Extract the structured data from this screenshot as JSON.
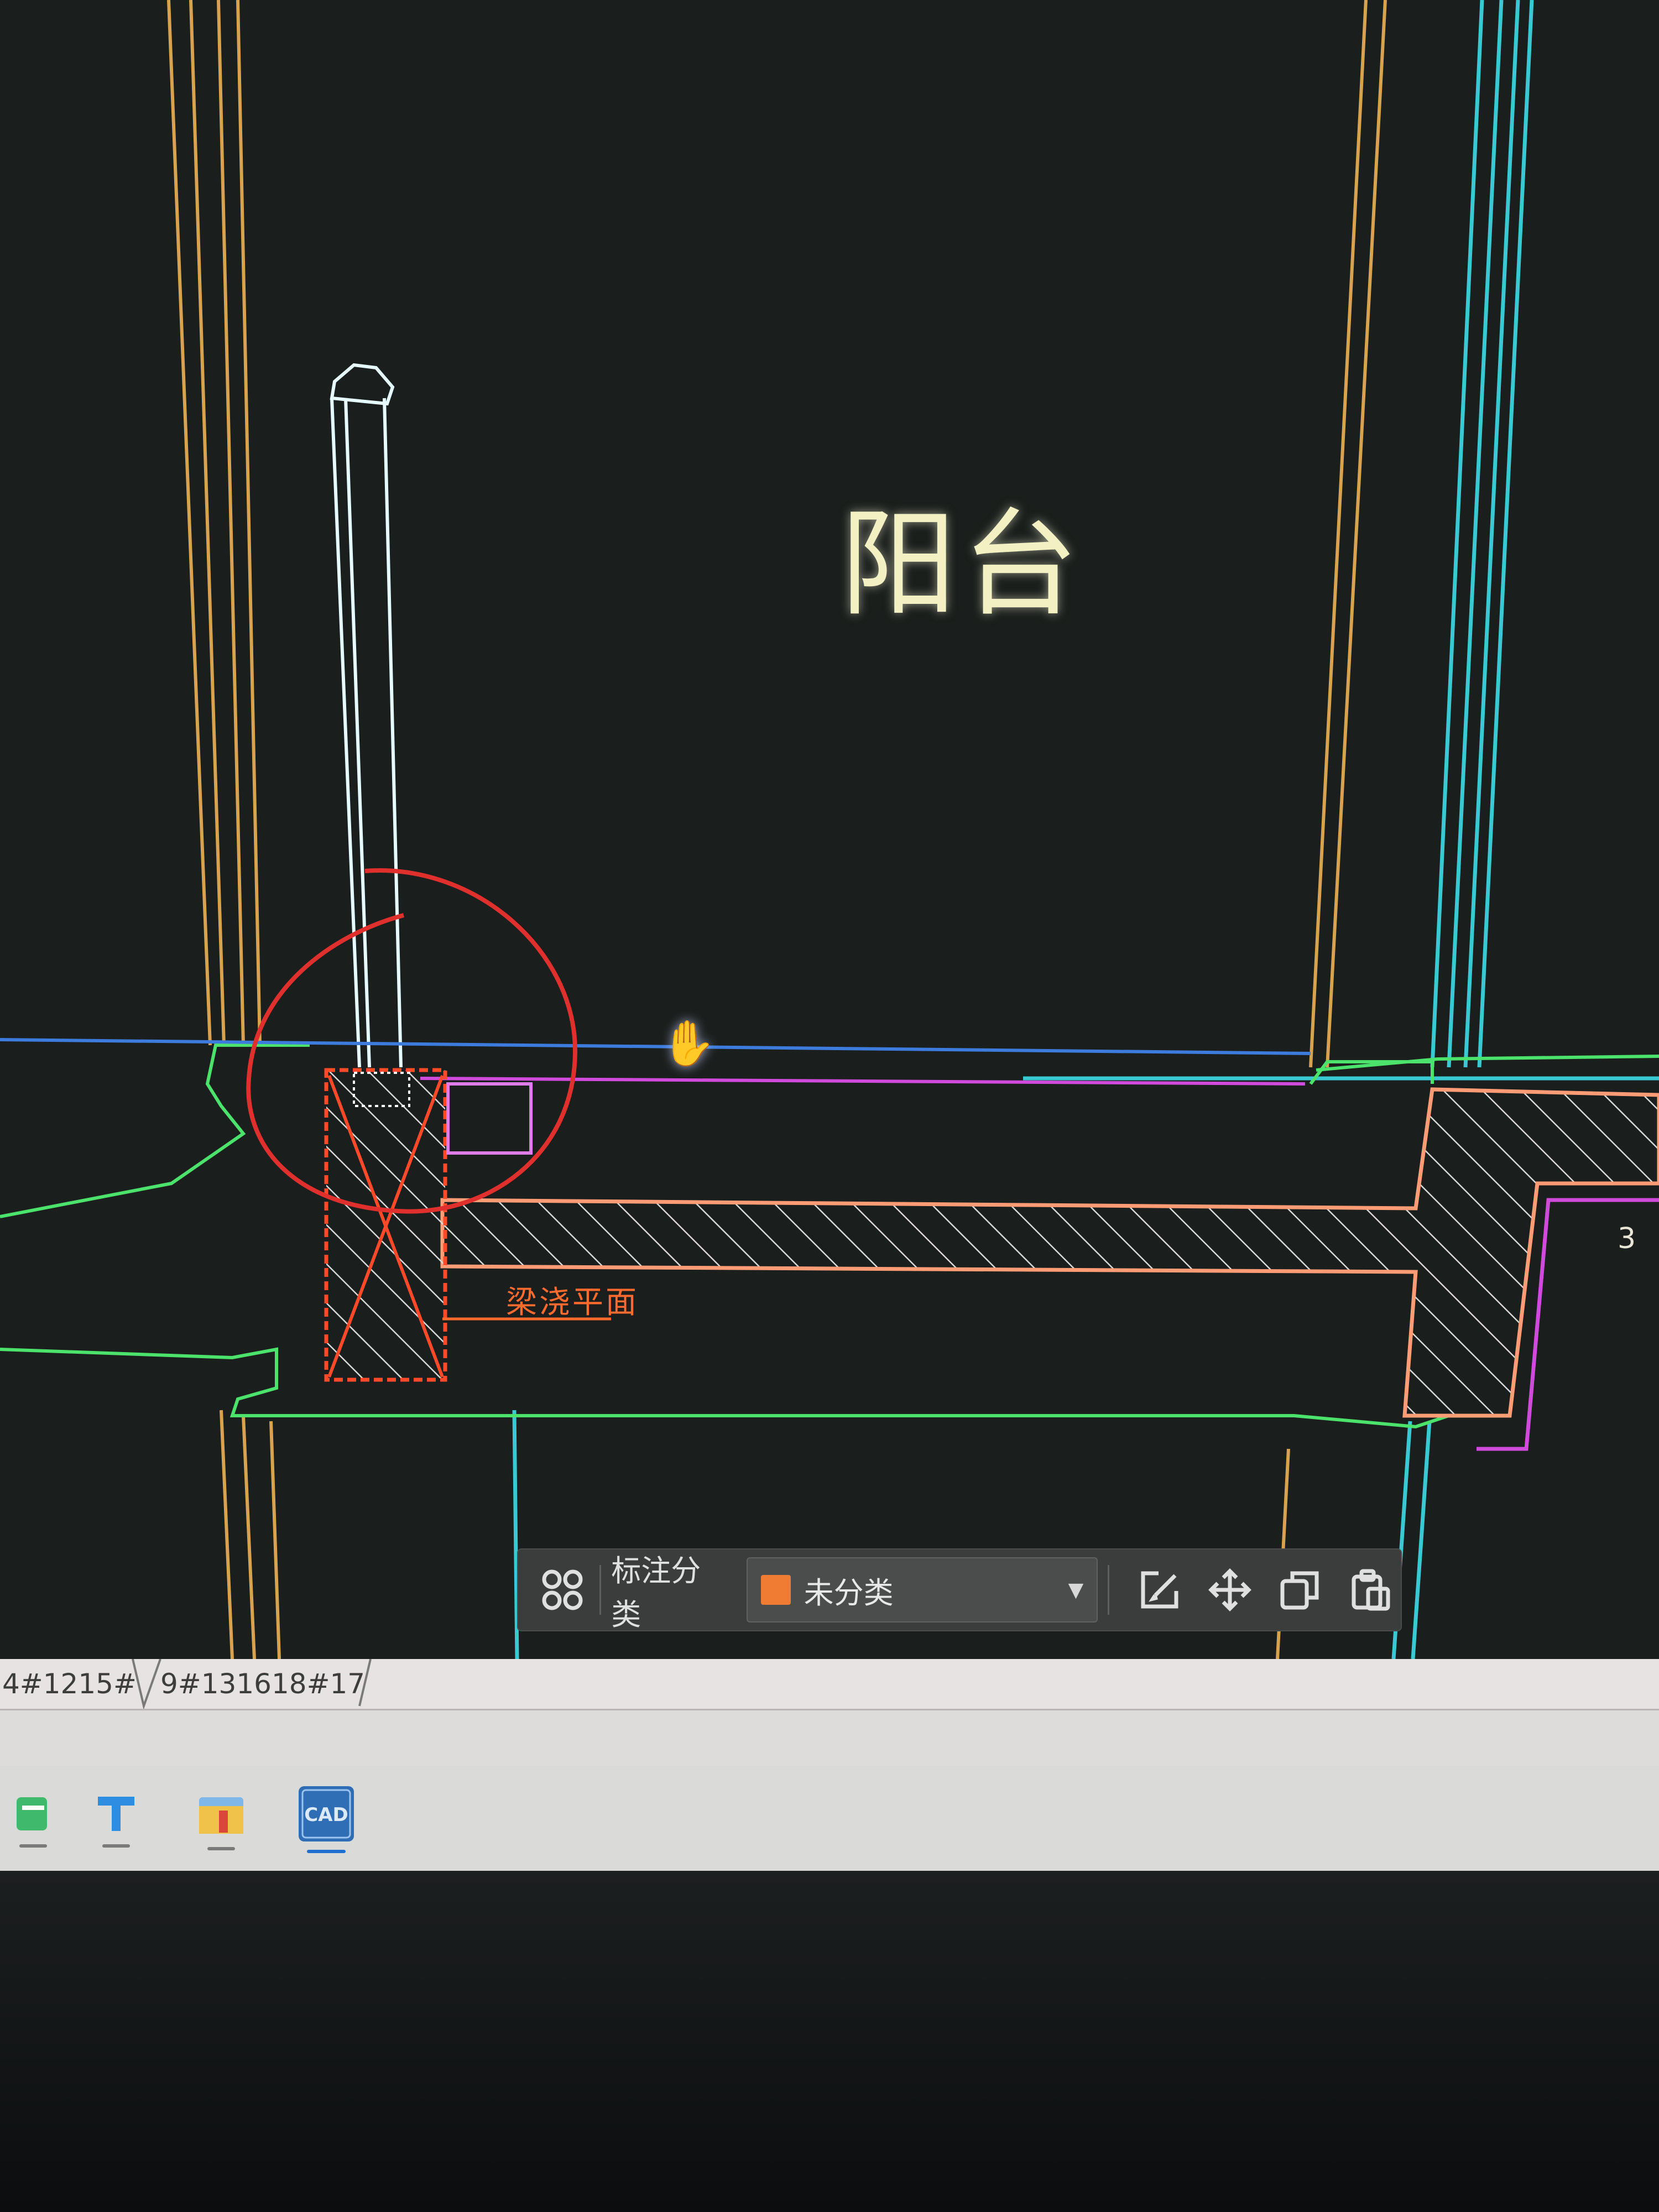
{
  "drawing": {
    "room_label": "阳台",
    "annotation_text": "梁浇平面",
    "side_mark": "3"
  },
  "toolbar": {
    "label": "标注分类",
    "category_value": "未分类",
    "category_color": "#f07c34",
    "icons": [
      "grid-icon",
      "edit-icon",
      "move-icon",
      "copy-icon",
      "paste-icon"
    ]
  },
  "layout_tabs": [
    "4#1215#",
    "9#131618#17"
  ],
  "taskbar": {
    "apps": [
      "green-app",
      "text-app",
      "folder-app",
      "CAD"
    ]
  },
  "colors": {
    "canvas": "#1a1e1c",
    "markup_circle": "#e0302e",
    "hatch_red": "#ff4a2a"
  }
}
